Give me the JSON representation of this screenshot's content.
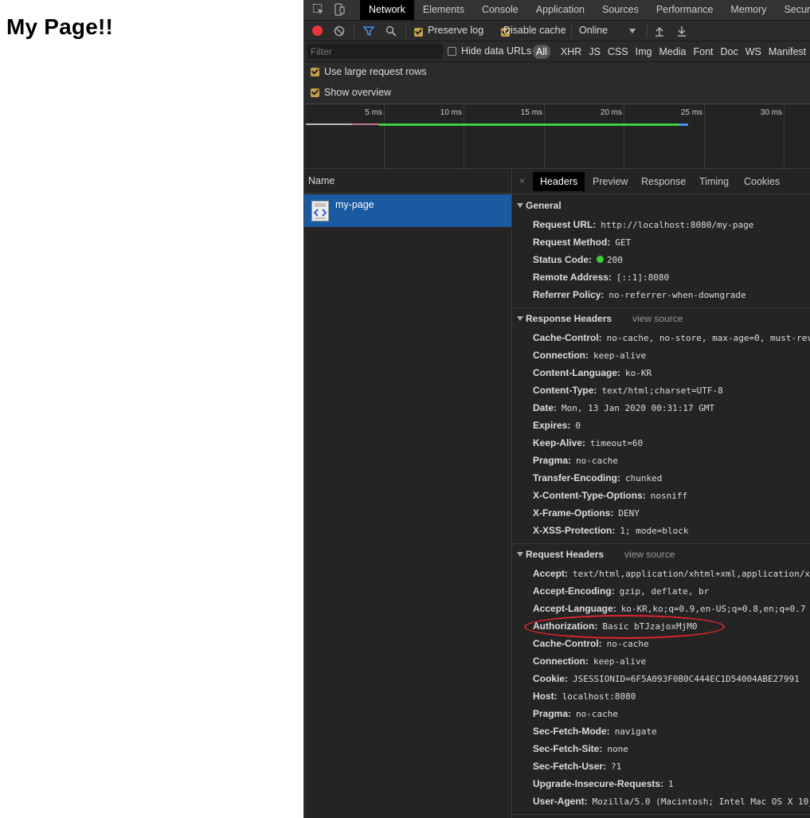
{
  "page": {
    "title": "My Page!!"
  },
  "devtools": {
    "tabs": [
      "Network",
      "Elements",
      "Console",
      "Application",
      "Sources",
      "Performance",
      "Memory",
      "Secur"
    ],
    "active_tab": "Network",
    "toolbar": {
      "preserve_log": "Preserve log",
      "disable_cache": "Disable cache",
      "throttling": "Online"
    },
    "filter": {
      "placeholder": "Filter",
      "hide_data_urls": "Hide data URLs",
      "types": [
        "All",
        "XHR",
        "JS",
        "CSS",
        "Img",
        "Media",
        "Font",
        "Doc",
        "WS",
        "Manifest"
      ]
    },
    "options": {
      "large_rows": "Use large request rows",
      "show_overview": "Show overview"
    },
    "timeline": {
      "ticks": [
        "5 ms",
        "10 ms",
        "15 ms",
        "20 ms",
        "25 ms",
        "30 ms"
      ]
    },
    "requests": {
      "column_name": "Name",
      "items": [
        {
          "name": "my-page"
        }
      ]
    },
    "details": {
      "tabs": [
        "Headers",
        "Preview",
        "Response",
        "Timing",
        "Cookies"
      ],
      "active_tab": "Headers",
      "close": "×",
      "general": {
        "title": "General",
        "rows": [
          {
            "key": "Request URL:",
            "value": "http://localhost:8080/my-page"
          },
          {
            "key": "Request Method:",
            "value": "GET"
          },
          {
            "key": "Status Code:",
            "value": "200"
          },
          {
            "key": "Remote Address:",
            "value": "[::1]:8080"
          },
          {
            "key": "Referrer Policy:",
            "value": "no-referrer-when-downgrade"
          }
        ]
      },
      "response_headers": {
        "title": "Response Headers",
        "view_source": "view source",
        "rows": [
          {
            "key": "Cache-Control:",
            "value": "no-cache, no-store, max-age=0, must-rev"
          },
          {
            "key": "Connection:",
            "value": "keep-alive"
          },
          {
            "key": "Content-Language:",
            "value": "ko-KR"
          },
          {
            "key": "Content-Type:",
            "value": "text/html;charset=UTF-8"
          },
          {
            "key": "Date:",
            "value": "Mon, 13 Jan 2020 00:31:17 GMT"
          },
          {
            "key": "Expires:",
            "value": "0"
          },
          {
            "key": "Keep-Alive:",
            "value": "timeout=60"
          },
          {
            "key": "Pragma:",
            "value": "no-cache"
          },
          {
            "key": "Transfer-Encoding:",
            "value": "chunked"
          },
          {
            "key": "X-Content-Type-Options:",
            "value": "nosniff"
          },
          {
            "key": "X-Frame-Options:",
            "value": "DENY"
          },
          {
            "key": "X-XSS-Protection:",
            "value": "1; mode=block"
          }
        ]
      },
      "request_headers": {
        "title": "Request Headers",
        "view_source": "view source",
        "rows": [
          {
            "key": "Accept:",
            "value": "text/html,application/xhtml+xml,application/x"
          },
          {
            "key": "Accept-Encoding:",
            "value": "gzip, deflate, br"
          },
          {
            "key": "Accept-Language:",
            "value": "ko-KR,ko;q=0.9,en-US;q=0.8,en;q=0.7"
          },
          {
            "key": "Authorization:",
            "value": "Basic bTJzajoxMjM0"
          },
          {
            "key": "Cache-Control:",
            "value": "no-cache"
          },
          {
            "key": "Connection:",
            "value": "keep-alive"
          },
          {
            "key": "Cookie:",
            "value": "JSESSIONID=6F5A093F0B0C444EC1D54004ABE27991"
          },
          {
            "key": "Host:",
            "value": "localhost:8080"
          },
          {
            "key": "Pragma:",
            "value": "no-cache"
          },
          {
            "key": "Sec-Fetch-Mode:",
            "value": "navigate"
          },
          {
            "key": "Sec-Fetch-Site:",
            "value": "none"
          },
          {
            "key": "Sec-Fetch-User:",
            "value": "?1"
          },
          {
            "key": "Upgrade-Insecure-Requests:",
            "value": "1"
          },
          {
            "key": "User-Agent:",
            "value": "Mozilla/5.0 (Macintosh; Intel Mac OS X 10_"
          }
        ]
      }
    },
    "colors": {
      "record": "#e8383d",
      "filter_active": "#4a8ff5",
      "checkbox": "#c7a04a",
      "selected_row": "#1a5aa0",
      "status_ok": "#3bcf3b",
      "annotation": "#e0232e",
      "timeline_green": "#3bcf3b",
      "timeline_blue": "#4a8ff5"
    }
  }
}
